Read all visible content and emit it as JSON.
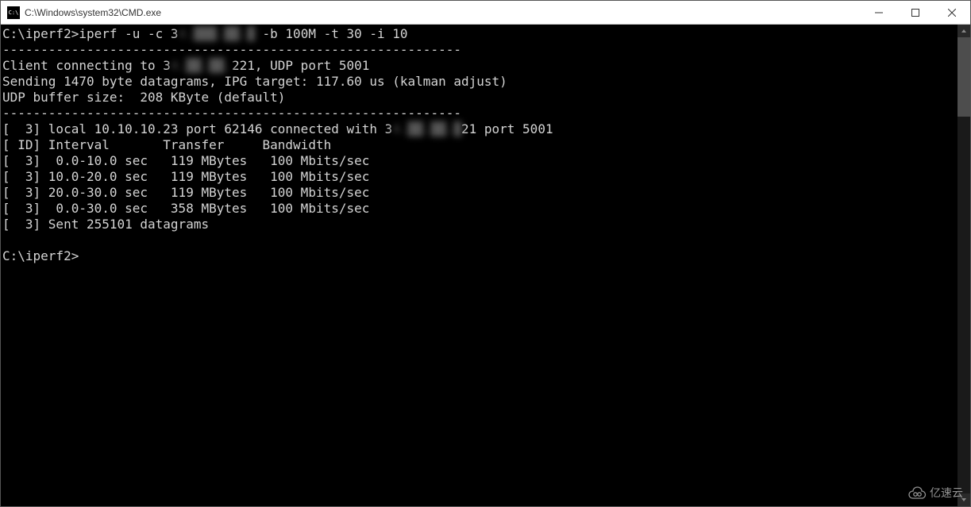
{
  "window": {
    "title": "C:\\Windows\\system32\\CMD.exe",
    "icon_label": "C:\\"
  },
  "terminal": {
    "prompt1": "C:\\iperf2>",
    "command_part1": "iperf -u -c 3",
    "command_redacted": "4.███.██.█",
    "command_part2": " -b 100M -t 30 -i 10",
    "divider": "------------------------------------------------------------",
    "client_line_part1": "Client connecting to 3",
    "client_redacted": "4.██.██.",
    "client_line_part2": "221, UDP port 5001",
    "sending_line": "Sending 1470 byte datagrams, IPG target: 117.60 us (kalman adjust)",
    "buffer_line": "UDP buffer size:  208 KByte (default)",
    "connected_part1": "[  3] local 10.10.10.23 port 62146 connected with 3",
    "connected_redacted": "4.██.██.█",
    "connected_part2": "21 port 5001",
    "header": "[ ID] Interval       Transfer     Bandwidth",
    "rows": [
      "[  3]  0.0-10.0 sec   119 MBytes   100 Mbits/sec",
      "[  3] 10.0-20.0 sec   119 MBytes   100 Mbits/sec",
      "[  3] 20.0-30.0 sec   119 MBytes   100 Mbits/sec",
      "[  3]  0.0-30.0 sec   358 MBytes   100 Mbits/sec"
    ],
    "sent_line": "[  3] Sent 255101 datagrams",
    "prompt2": "C:\\iperf2>"
  },
  "watermark": {
    "text": "亿速云"
  }
}
